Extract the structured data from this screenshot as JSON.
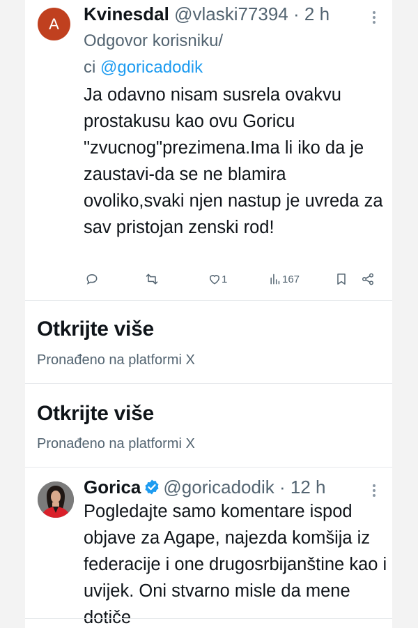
{
  "tweet1": {
    "avatar_letter": "A",
    "avatar_color": "#c0401f",
    "name": "Kvinesdal",
    "handle": "@vlaski77394",
    "separator": " · ",
    "time": "2 h",
    "reply_prefix_line1": "Odgovor korisniku/",
    "reply_prefix_line2": "ci ",
    "reply_mention": "@goricadodik",
    "body": "Ja odavno nisam susrela ovakvu prostakusu kao ovu Goricu \"zvucnog\"prezimena.Ima li iko da je zaustavi-da se ne blamira ovoliko,svaki njen nastup je uvreda za sav pristojan zenski rod!",
    "likes": "1",
    "views": "167"
  },
  "discover": [
    {
      "title": "Otkrijte više",
      "subtitle": "Pronađeno na platformi X"
    },
    {
      "title": "Otkrijte više",
      "subtitle": "Pronađeno na platformi X"
    }
  ],
  "tweet2": {
    "name": "Gorica",
    "handle": "@goricadodik",
    "separator": " · ",
    "time": "12 h",
    "body": "Pogledajte samo komentare ispod objave za Agape, najezda komšija iz federacije i one drugosrbijanštine kao i uvijek. Oni stvarno misle da mene dotiče"
  },
  "colors": {
    "accent": "#1d9bf0",
    "muted_text": "#536471",
    "text": "#0f1419",
    "avatar_red": "#c0401f"
  }
}
